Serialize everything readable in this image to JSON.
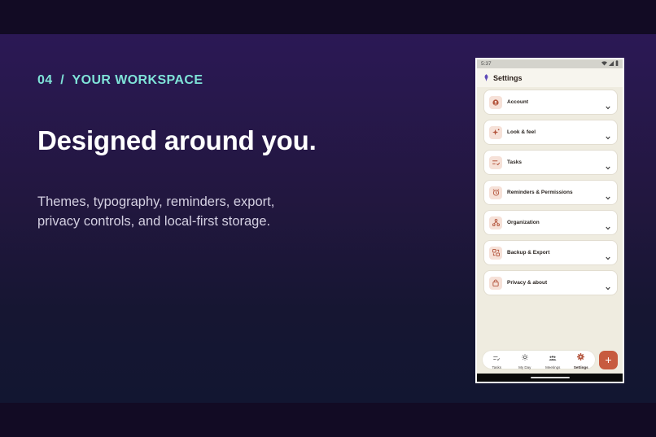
{
  "slide": {
    "kicker": "04  /  YOUR WORKSPACE",
    "headline": "Designed around you.",
    "body_lines": [
      "Themes, typography, reminders, export,",
      "privacy controls, and local-first storage."
    ]
  },
  "phone": {
    "status_time": "5:37",
    "status_icons": [
      "wifi-icon",
      "signal-icon",
      "battery-icon"
    ],
    "app_title": "Settings",
    "app_icon": "feather-logo-icon",
    "settings_items": [
      {
        "label": "Account",
        "icon": "account-icon"
      },
      {
        "label": "Look & feel",
        "icon": "sparkle-icon"
      },
      {
        "label": "Tasks",
        "icon": "tasks-icon"
      },
      {
        "label": "Reminders & Permissions",
        "icon": "alarm-icon"
      },
      {
        "label": "Organization",
        "icon": "organization-icon"
      },
      {
        "label": "Backup & Export",
        "icon": "backup-icon"
      },
      {
        "label": "Privacy & about",
        "icon": "lock-icon"
      }
    ],
    "nav": [
      {
        "label": "Tasks",
        "icon": "tasks-nav-icon",
        "active": false
      },
      {
        "label": "My Day",
        "icon": "sun-icon",
        "active": false
      },
      {
        "label": "Meetings",
        "icon": "people-icon",
        "active": false
      },
      {
        "label": "Settings",
        "icon": "gear-icon",
        "active": true
      }
    ],
    "fab_label": "+"
  },
  "colors": {
    "kicker": "#7fe3d8",
    "accent": "#c75b3f",
    "screen_bg": "#efece0",
    "icon_tile": "#f6e1d8"
  }
}
